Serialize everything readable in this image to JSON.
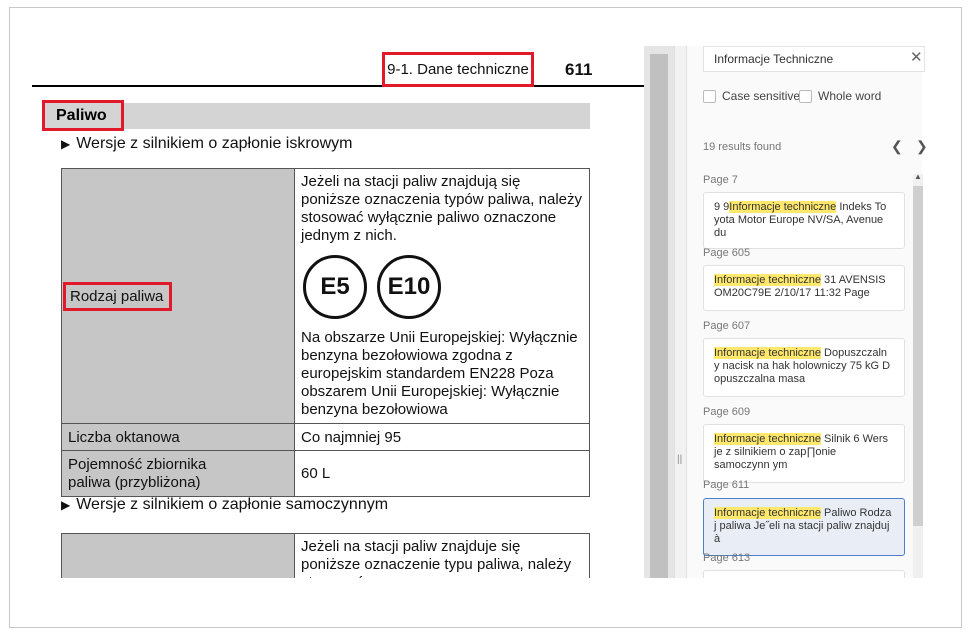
{
  "document": {
    "running_title": "9-1. Dane techniczne",
    "page_number": "611",
    "section_title": "Paliwo",
    "subsection_1": "Wersje z silnikiem o zapłonie iskrowym",
    "subsection_2": "Wersje z silnikiem o zapłonie samoczynnym",
    "table_1": {
      "row_fuel_type": {
        "label": "Rodzaj paliwa",
        "intro": "Jeżeli na stacji paliw znajdują się poniższe oznaczenia typów paliwa, należy stosować wyłącznie paliwo oznaczone jednym z nich.",
        "badge_1": "E5",
        "badge_2": "E10",
        "details": "Na obszarze Unii Europejskiej: Wyłącznie benzyna bezołowiowa zgodna z europejskim standardem EN228 Poza obszarem Unii Europejskiej: Wyłącznie benzyna bezołowiowa"
      },
      "row_octane": {
        "label": "Liczba oktanowa",
        "value": "Co najmniej 95"
      },
      "row_tank": {
        "label": "Pojemność zbiornika paliwa (przybliżona)",
        "value": "60 L"
      }
    },
    "table_2": {
      "intro": "Jeżeli na stacji paliw znajduje się poniższe oznaczenie typu paliwa, należy stosować"
    }
  },
  "search_panel": {
    "query": "Informacje Techniczne",
    "case_sensitive_label": "Case sensitive",
    "whole_word_label": "Whole word",
    "results_count": "19 results found",
    "highlight_term": "Informacje techniczne",
    "results": [
      {
        "page": "Page 7",
        "prefix": "9 9",
        "rest": " Indeks To yota Motor Europe NV/SA, Avenue du"
      },
      {
        "page": "Page 605",
        "prefix": "",
        "rest": " 31 AVENSIS OM20C79E 2/10/17 11:32 Page"
      },
      {
        "page": "Page 607",
        "prefix": "",
        "rest": " Dopuszczaln y nacisk na hak holowniczy 75 kG D opuszczalna masa"
      },
      {
        "page": "Page 609",
        "prefix": "",
        "rest": " Silnik 6 Wers je z silnikiem o zap∏onie samoczynn ym"
      },
      {
        "page": "Page 611",
        "prefix": "",
        "rest": " Paliwo Rodza j paliwa Je˝eli na stacji paliw znajduj à"
      },
      {
        "page": "Page 613",
        "prefix": "",
        "rest": ""
      }
    ]
  }
}
